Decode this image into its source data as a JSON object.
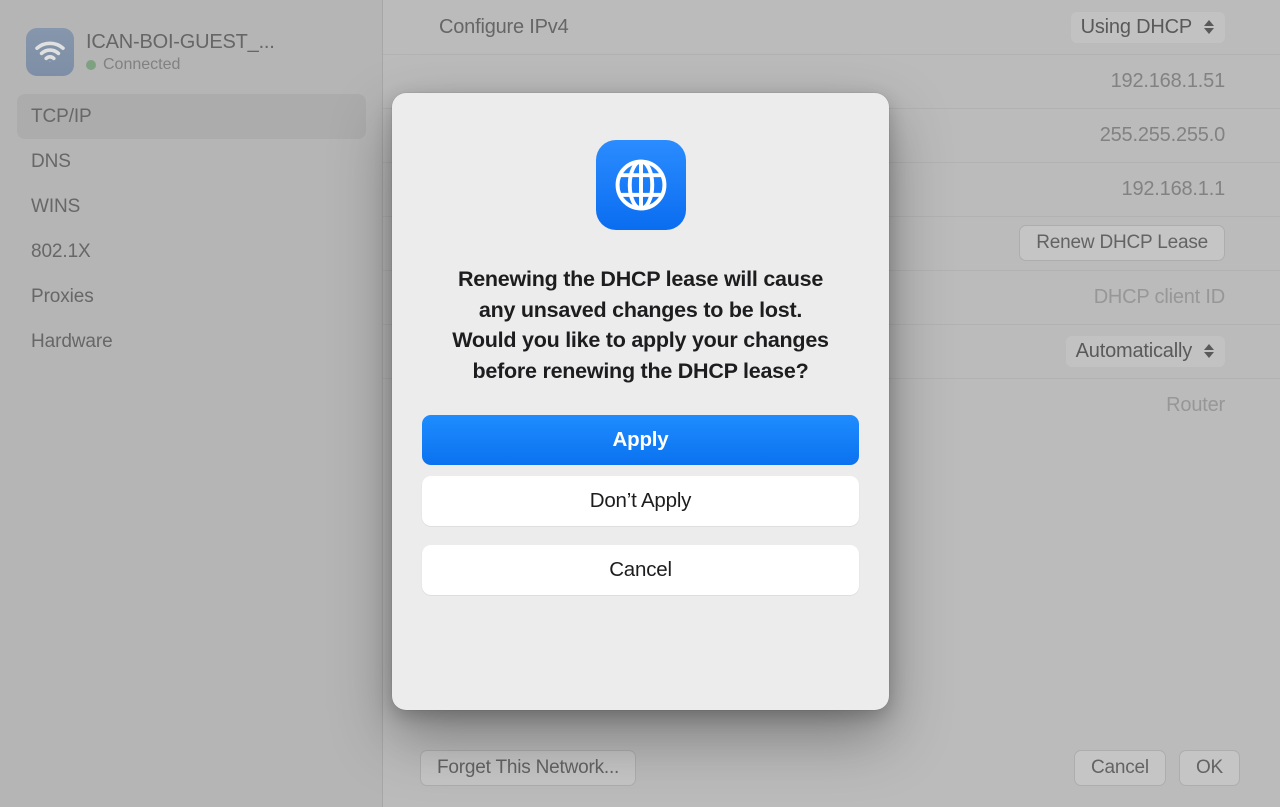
{
  "sidebar": {
    "network": {
      "name": "ICAN-BOI-GUEST_...",
      "status": "Connected",
      "icon": "wifi-icon",
      "status_dot_color": "#72c077"
    },
    "items": [
      {
        "label": "TCP/IP",
        "selected": true
      },
      {
        "label": "DNS",
        "selected": false
      },
      {
        "label": "WINS",
        "selected": false
      },
      {
        "label": "802.1X",
        "selected": false
      },
      {
        "label": "Proxies",
        "selected": false
      },
      {
        "label": "Hardware",
        "selected": false
      }
    ]
  },
  "content": {
    "rows": [
      {
        "label": "Configure IPv4",
        "value": "Using DHCP",
        "kind": "popup"
      },
      {
        "label": "",
        "value": "192.168.1.51",
        "kind": "value"
      },
      {
        "label": "",
        "value": "255.255.255.0",
        "kind": "value"
      },
      {
        "label": "",
        "value": "192.168.1.1",
        "kind": "value"
      },
      {
        "label": "",
        "value": "Renew DHCP Lease",
        "kind": "button"
      },
      {
        "label": "",
        "value": "DHCP client ID",
        "kind": "placeholder"
      },
      {
        "label": "",
        "value": "Automatically",
        "kind": "popup"
      },
      {
        "label": "",
        "value": "Router",
        "kind": "placeholder"
      }
    ],
    "bottom": {
      "forget_label": "Forget This Network...",
      "cancel_label": "Cancel",
      "ok_label": "OK"
    }
  },
  "alert": {
    "icon": "globe-icon",
    "message": "Renewing the DHCP lease will cause any unsaved changes to be lost. Would you like to apply your changes before renewing the DHCP lease?",
    "buttons": {
      "apply": "Apply",
      "dont_apply": "Don’t Apply",
      "cancel": "Cancel"
    },
    "accent_color": "#0a72ef"
  }
}
